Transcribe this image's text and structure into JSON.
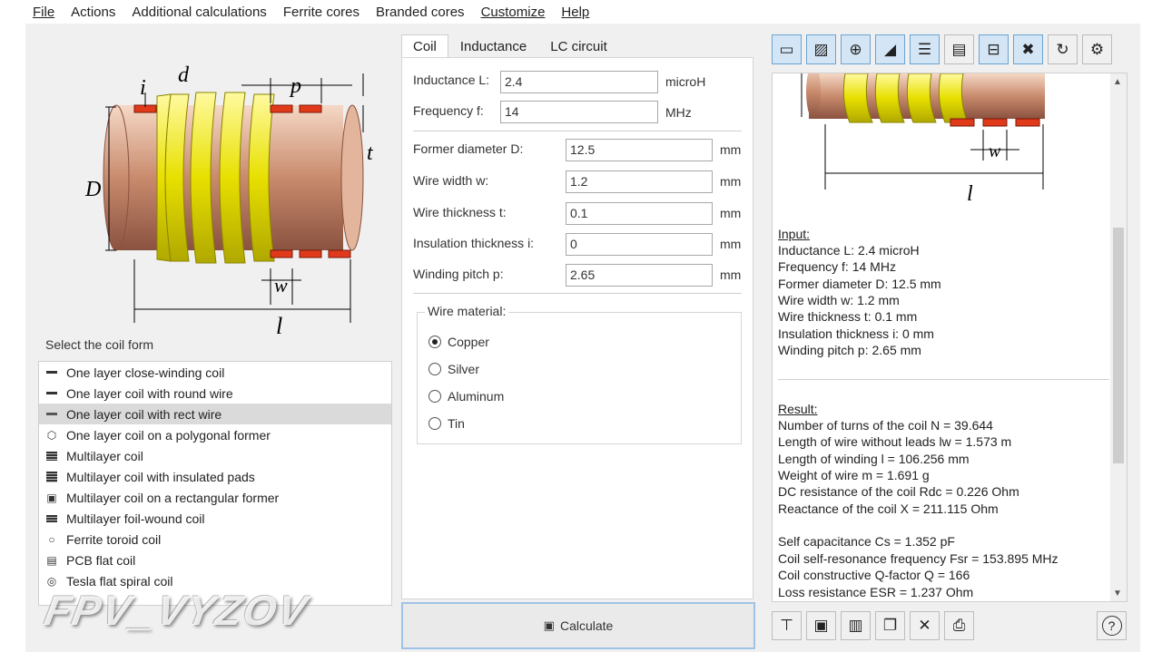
{
  "menu": [
    "File",
    "Actions",
    "Additional calculations",
    "Ferrite cores",
    "Branded cores",
    "Customize",
    "Help"
  ],
  "diagram": {
    "i": "i",
    "d": "d",
    "p": "p",
    "t": "t",
    "D": "D",
    "w": "w",
    "l": "l"
  },
  "coil_form": {
    "label": "Select the coil form",
    "items": [
      {
        "label": "One layer close-winding coil",
        "icon": "dash-icon"
      },
      {
        "label": "One layer coil with round wire",
        "icon": "dash-icon"
      },
      {
        "label": "One layer coil with rect wire",
        "icon": "dash-icon",
        "selected": true
      },
      {
        "label": "One layer coil on a polygonal former",
        "icon": "hexagon-icon"
      },
      {
        "label": "Multilayer coil",
        "icon": "multilayer-icon"
      },
      {
        "label": "Multilayer coil with insulated pads",
        "icon": "multilayer-pads-icon"
      },
      {
        "label": "Multilayer coil on a rectangular former",
        "icon": "rect-former-icon"
      },
      {
        "label": "Multilayer foil-wound coil",
        "icon": "foil-icon"
      },
      {
        "label": "Ferrite toroid coil",
        "icon": "toroid-icon"
      },
      {
        "label": "PCB flat coil",
        "icon": "pcb-icon"
      },
      {
        "label": "Tesla flat spiral coil",
        "icon": "spiral-icon"
      }
    ]
  },
  "watermark": "FPV_VYZOV",
  "tabs": [
    "Coil",
    "Inductance",
    "LC circuit"
  ],
  "fields": {
    "inductance": {
      "label": "Inductance L:",
      "value": "2.4",
      "unit": "microH"
    },
    "frequency": {
      "label": "Frequency f:",
      "value": "14",
      "unit": "MHz"
    },
    "former_diameter": {
      "label": "Former diameter D:",
      "value": "12.5",
      "unit": "mm"
    },
    "wire_width": {
      "label": "Wire width w:",
      "value": "1.2",
      "unit": "mm"
    },
    "wire_thickness": {
      "label": "Wire thickness t:",
      "value": "0.1",
      "unit": "mm"
    },
    "insulation": {
      "label": "Insulation thickness i:",
      "value": "0",
      "unit": "mm"
    },
    "pitch": {
      "label": "Winding pitch p:",
      "value": "2.65",
      "unit": "mm"
    }
  },
  "wire_material": {
    "title": "Wire material:",
    "options": [
      "Copper",
      "Silver",
      "Aluminum",
      "Tin"
    ],
    "selected": "Copper"
  },
  "calculate_label": "Calculate",
  "result_panel": {
    "diagram_w": "w",
    "diagram_l": "l",
    "input_title": "Input:",
    "input_lines": [
      "Inductance L: 2.4 microH",
      "Frequency f: 14 MHz",
      "Former diameter D: 12.5 mm",
      "Wire width w: 1.2 mm",
      "Wire thickness t: 0.1 mm",
      "Insulation thickness i: 0 mm",
      "Winding pitch p: 2.65 mm"
    ],
    "result_title": "Result:",
    "result_lines": [
      "Number of turns of the coil N = 39.644",
      "Length of wire without leads lw = 1.573 m",
      "Length of winding l = 106.256 mm",
      "Weight of wire m = 1.691 g",
      "DC resistance of the coil Rdc = 0.226 Ohm",
      "Reactance of the coil X = 211.115 Ohm"
    ],
    "extra_lines": [
      "Self capacitance Cs = 1.352 pF",
      "Coil self-resonance frequency Fsr = 153.895 MHz",
      "Coil constructive Q-factor Q = 166",
      "Loss resistance ESR = 1.237 Ohm"
    ]
  },
  "colors": {
    "accent": "#d4e6f5",
    "copper": "#c98b6d",
    "winding": "#e8e000",
    "insulation": "#e03a1a"
  }
}
